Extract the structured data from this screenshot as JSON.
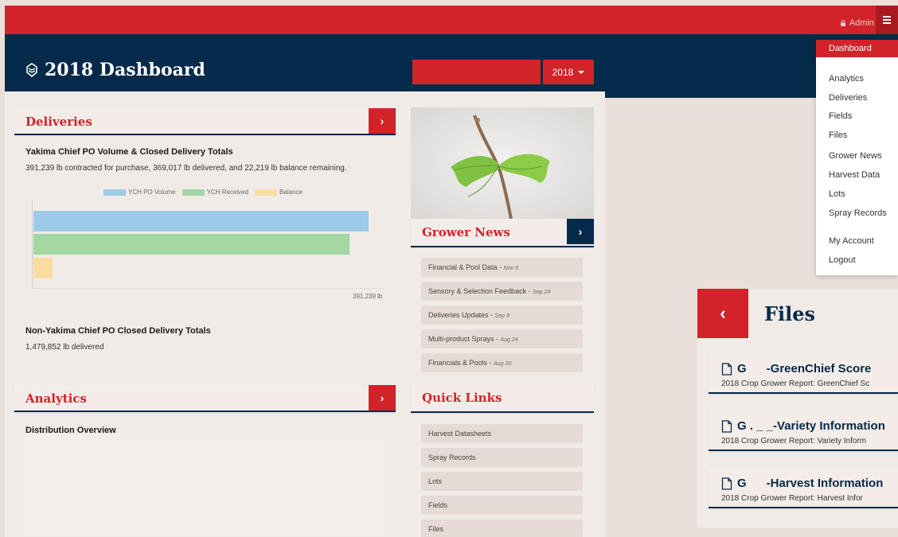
{
  "header": {
    "admin_label": "Admin",
    "title": "2018 Dashboard",
    "year": "2018"
  },
  "deliveries": {
    "title": "Deliveries",
    "heading": "Yakima Chief PO Volume & Closed Delivery Totals",
    "summary": "391,239 lb contracted for purchase, 369,017 lb delivered, and 22,219 lb balance remaining.",
    "legend": [
      "YCH PO Volume",
      "YCH Received",
      "Balance"
    ],
    "axis_max_label": "391,239 lb",
    "non_heading": "Non-Yakima Chief PO Closed Delivery Totals",
    "non_text": "1,479,852 lb delivered"
  },
  "chart_data": {
    "type": "bar",
    "orientation": "horizontal",
    "categories": [
      "YCH PO Volume",
      "YCH Received",
      "Balance"
    ],
    "values": [
      391239,
      369017,
      22219
    ],
    "colors": [
      "#9ccbea",
      "#a2d8a2",
      "#f8dca0"
    ],
    "xlim": [
      0,
      391239
    ]
  },
  "analytics": {
    "title": "Analytics",
    "heading": "Distribution Overview"
  },
  "grower_news": {
    "title": "Grower News",
    "items": [
      {
        "label": "Financial & Pool Data",
        "date": "Nov 9"
      },
      {
        "label": "Sensory & Selection Feedback",
        "date": "Sep 24"
      },
      {
        "label": "Deliveries Updates",
        "date": "Sep 9"
      },
      {
        "label": "Multi-product Sprays",
        "date": "Aug 24"
      },
      {
        "label": "Financials & Pools",
        "date": "Aug 20"
      }
    ]
  },
  "quick_links": {
    "title": "Quick Links",
    "items": [
      "Harvest Datasheets",
      "Spray Records",
      "Lots",
      "Fields",
      "Files"
    ]
  },
  "menu": {
    "active": "Dashboard",
    "items": [
      "Analytics",
      "Deliveries",
      "Fields",
      "Files",
      "Grower News",
      "Harvest Data",
      "Lots",
      "Spray Records"
    ],
    "account": [
      "My Account",
      "Logout"
    ]
  },
  "files": {
    "title": "Files",
    "items": [
      {
        "title": "G      -GreenChief Score",
        "sub": "2018 Crop Grower Report: GreenChief Sc"
      },
      {
        "title": "G . _ _-Variety Information",
        "sub": "2018 Crop Grower Report: Variety Inform"
      },
      {
        "title": "G      -Harvest Information",
        "sub": "2018 Crop Grower Report: Harvest Infor"
      }
    ]
  },
  "colors": {
    "brand_red": "#d2232a",
    "brand_navy": "#062a4a",
    "page_bg": "#ebe0d9"
  }
}
